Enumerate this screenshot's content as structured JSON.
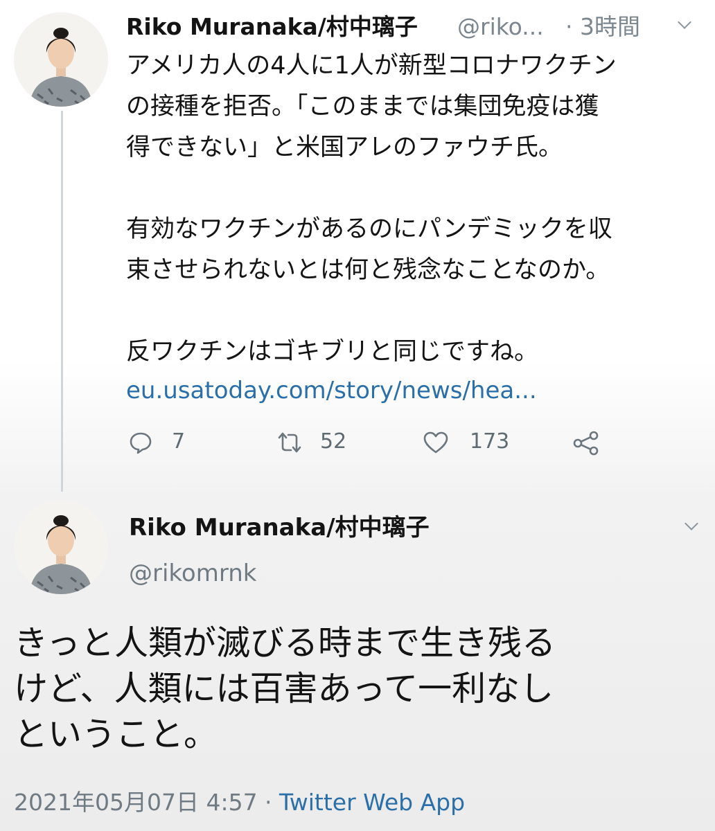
{
  "tweet1": {
    "display_name": "Riko Muranaka/村中璃子",
    "handle": "@riko...",
    "separator_time": "· 3時間",
    "body_lines": [
      "アメリカ人の4人に1人が新型コロナワクチン",
      "の接種を拒否。「このままでは集団免疫は獲",
      "得できない」と米国アレのファウチ氏。",
      "有効なワクチンがあるのにパンデミックを収",
      "束させられないとは何と残念なことなのか。",
      "反ワクチンはゴキブリと同じですね。"
    ],
    "link": "eu.usatoday.com/story/news/hea...",
    "actions": {
      "reply_count": "7",
      "retweet_count": "52",
      "like_count": "173"
    }
  },
  "tweet2": {
    "display_name": "Riko Muranaka/村中璃子",
    "handle": "@rikomrnk",
    "body_lines": [
      "きっと人類が滅びる時まで生き残る",
      "けど、人類には百害あって一利なし",
      "ということ。"
    ],
    "timestamp": "2021年05月07日 4:57",
    "meta_separator": " · ",
    "source_app": "Twitter Web App"
  },
  "colors": {
    "text": "#141414",
    "secondary": "#7b868f",
    "link": "#2b6fa8",
    "thread_line": "#cfd5da"
  },
  "icons": [
    "reply-icon",
    "retweet-icon",
    "like-icon",
    "share-icon",
    "chevron-down-icon"
  ]
}
